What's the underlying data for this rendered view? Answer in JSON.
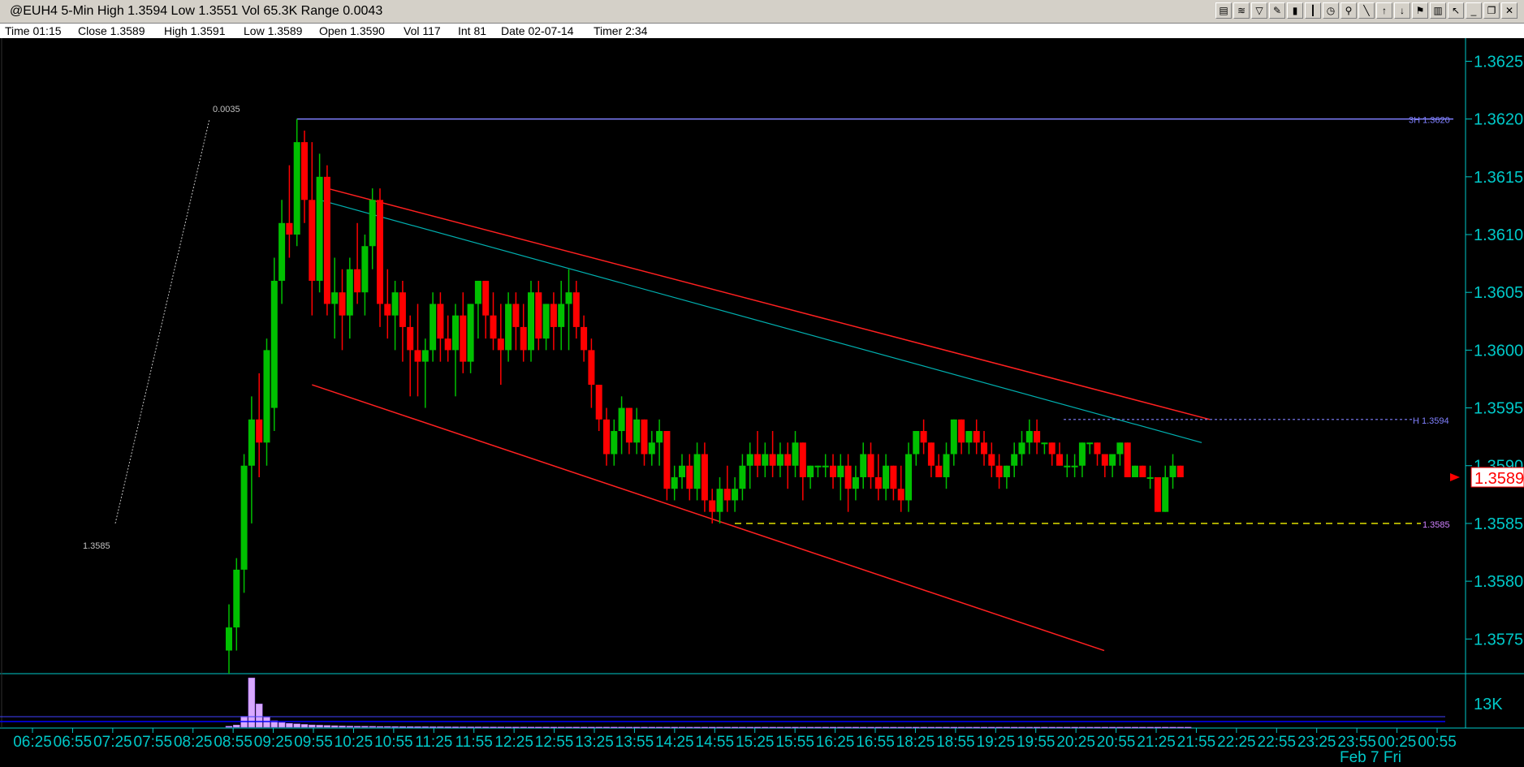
{
  "window": {
    "title": "@EUH4 5-Min High 1.3594 Low 1.3551 Vol 65.3K Range 0.0043",
    "toolbar_icons": [
      "chart-icon",
      "drawing-icon",
      "indicator-icon",
      "pencil-icon",
      "bar-chart-icon",
      "candle-icon",
      "clock-icon",
      "zoom-icon",
      "line-tool-icon",
      "arrow-up-icon",
      "arrow-down-icon",
      "marker-icon",
      "trash-icon",
      "cursor-icon",
      "minimize-icon",
      "restore-icon",
      "close-icon"
    ]
  },
  "infobar": {
    "time": "Time 01:15",
    "close": "Close 1.3589",
    "high": "High 1.3591",
    "low": "Low 1.3589",
    "open": "Open 1.3590",
    "vol": "Vol 117",
    "int": "Int 81",
    "date": "Date 02-07-14",
    "timer": "Timer 2:34"
  },
  "chart_data": {
    "type": "candlestick",
    "symbol": "@EUH4",
    "interval": "5-Min",
    "ylim": [
      1.3572,
      1.3627
    ],
    "y_ticks": [
      "1.3625",
      "1.3620",
      "1.3615",
      "1.3610",
      "1.3605",
      "1.3600",
      "1.3595",
      "1.3590",
      "1.3585",
      "1.3580",
      "1.3575"
    ],
    "last_price": "1.3589",
    "last_price_color": "#ff0000",
    "up_color": "#00c000",
    "down_color": "#ff0000",
    "x_labels": [
      "06:25",
      "06:55",
      "07:25",
      "07:55",
      "08:25",
      "08:55",
      "09:25",
      "09:55",
      "10:25",
      "10:55",
      "11:25",
      "11:55",
      "12:25",
      "12:55",
      "13:25",
      "13:55",
      "14:25",
      "14:55",
      "15:25",
      "15:55",
      "16:25",
      "16:55",
      "18:25",
      "18:55",
      "19:25",
      "19:55",
      "20:25",
      "20:55",
      "21:25",
      "21:55",
      "22:25",
      "22:55",
      "23:25",
      "23:55",
      "00:25",
      "00:55"
    ],
    "date_label": "Feb 7 Fri",
    "annotations": {
      "range_label_top": "0.0035",
      "range_label_bottom": "1.3585",
      "high_line_label": "3H 1.3620",
      "high_line_value": 1.362,
      "h_line_label": "H 1.3594",
      "h_line_value": 1.3594,
      "low_line_label": "1.3585",
      "low_line_value": 1.3585
    },
    "volume_scale_label": "13K",
    "bars": [
      {
        "o": 1.3574,
        "h": 1.3578,
        "l": 1.3572,
        "c": 1.3576
      },
      {
        "o": 1.3576,
        "h": 1.3582,
        "l": 1.3574,
        "c": 1.3581
      },
      {
        "o": 1.3581,
        "h": 1.3591,
        "l": 1.3579,
        "c": 1.359
      },
      {
        "o": 1.359,
        "h": 1.3596,
        "l": 1.3585,
        "c": 1.3594
      },
      {
        "o": 1.3594,
        "h": 1.3598,
        "l": 1.3589,
        "c": 1.3592
      },
      {
        "o": 1.3592,
        "h": 1.3601,
        "l": 1.359,
        "c": 1.36
      },
      {
        "o": 1.3595,
        "h": 1.3608,
        "l": 1.3593,
        "c": 1.3606
      },
      {
        "o": 1.3606,
        "h": 1.3613,
        "l": 1.3604,
        "c": 1.3611
      },
      {
        "o": 1.3611,
        "h": 1.3616,
        "l": 1.3608,
        "c": 1.361
      },
      {
        "o": 1.361,
        "h": 1.362,
        "l": 1.3609,
        "c": 1.3618
      },
      {
        "o": 1.3618,
        "h": 1.3619,
        "l": 1.3611,
        "c": 1.3613
      },
      {
        "o": 1.3613,
        "h": 1.3618,
        "l": 1.3603,
        "c": 1.3606
      },
      {
        "o": 1.3606,
        "h": 1.3617,
        "l": 1.3605,
        "c": 1.3615
      },
      {
        "o": 1.3615,
        "h": 1.3616,
        "l": 1.3603,
        "c": 1.3604
      },
      {
        "o": 1.3604,
        "h": 1.3608,
        "l": 1.3601,
        "c": 1.3605
      },
      {
        "o": 1.3605,
        "h": 1.3607,
        "l": 1.36,
        "c": 1.3603
      },
      {
        "o": 1.3603,
        "h": 1.3608,
        "l": 1.3601,
        "c": 1.3607
      },
      {
        "o": 1.3607,
        "h": 1.3611,
        "l": 1.3604,
        "c": 1.3605
      },
      {
        "o": 1.3605,
        "h": 1.361,
        "l": 1.3603,
        "c": 1.3609
      },
      {
        "o": 1.3609,
        "h": 1.3614,
        "l": 1.3607,
        "c": 1.3613
      },
      {
        "o": 1.3613,
        "h": 1.3614,
        "l": 1.3602,
        "c": 1.3604
      },
      {
        "o": 1.3604,
        "h": 1.3607,
        "l": 1.3601,
        "c": 1.3603
      },
      {
        "o": 1.3603,
        "h": 1.3606,
        "l": 1.36,
        "c": 1.3605
      },
      {
        "o": 1.3605,
        "h": 1.3606,
        "l": 1.3599,
        "c": 1.3602
      },
      {
        "o": 1.3602,
        "h": 1.3603,
        "l": 1.3596,
        "c": 1.36
      },
      {
        "o": 1.36,
        "h": 1.3604,
        "l": 1.3596,
        "c": 1.3599
      },
      {
        "o": 1.3599,
        "h": 1.3601,
        "l": 1.3595,
        "c": 1.36
      },
      {
        "o": 1.36,
        "h": 1.3605,
        "l": 1.3599,
        "c": 1.3604
      },
      {
        "o": 1.3604,
        "h": 1.3605,
        "l": 1.3599,
        "c": 1.3601
      },
      {
        "o": 1.3601,
        "h": 1.3603,
        "l": 1.3599,
        "c": 1.36
      },
      {
        "o": 1.36,
        "h": 1.3604,
        "l": 1.3596,
        "c": 1.3603
      },
      {
        "o": 1.3603,
        "h": 1.3605,
        "l": 1.3598,
        "c": 1.3599
      },
      {
        "o": 1.3599,
        "h": 1.3604,
        "l": 1.3598,
        "c": 1.3604
      },
      {
        "o": 1.3604,
        "h": 1.3606,
        "l": 1.3601,
        "c": 1.3606
      },
      {
        "o": 1.3606,
        "h": 1.3606,
        "l": 1.3601,
        "c": 1.3603
      },
      {
        "o": 1.3603,
        "h": 1.3605,
        "l": 1.36,
        "c": 1.3601
      },
      {
        "o": 1.3601,
        "h": 1.3604,
        "l": 1.3597,
        "c": 1.36
      },
      {
        "o": 1.36,
        "h": 1.3605,
        "l": 1.3599,
        "c": 1.3604
      },
      {
        "o": 1.3604,
        "h": 1.3605,
        "l": 1.36,
        "c": 1.3602
      },
      {
        "o": 1.3602,
        "h": 1.3604,
        "l": 1.3599,
        "c": 1.36
      },
      {
        "o": 1.36,
        "h": 1.3606,
        "l": 1.3599,
        "c": 1.3605
      },
      {
        "o": 1.3605,
        "h": 1.3606,
        "l": 1.36,
        "c": 1.3601
      },
      {
        "o": 1.3601,
        "h": 1.3604,
        "l": 1.36,
        "c": 1.3604
      },
      {
        "o": 1.3604,
        "h": 1.3605,
        "l": 1.36,
        "c": 1.3602
      },
      {
        "o": 1.3602,
        "h": 1.3606,
        "l": 1.36,
        "c": 1.3604
      },
      {
        "o": 1.3604,
        "h": 1.3607,
        "l": 1.36,
        "c": 1.3605
      },
      {
        "o": 1.3605,
        "h": 1.3606,
        "l": 1.3601,
        "c": 1.3602
      },
      {
        "o": 1.3602,
        "h": 1.3603,
        "l": 1.3599,
        "c": 1.36
      },
      {
        "o": 1.36,
        "h": 1.3601,
        "l": 1.3595,
        "c": 1.3597
      },
      {
        "o": 1.3597,
        "h": 1.3597,
        "l": 1.3593,
        "c": 1.3594
      },
      {
        "o": 1.3594,
        "h": 1.3595,
        "l": 1.359,
        "c": 1.3591
      },
      {
        "o": 1.3591,
        "h": 1.3594,
        "l": 1.359,
        "c": 1.3593
      },
      {
        "o": 1.3593,
        "h": 1.3596,
        "l": 1.3591,
        "c": 1.3595
      },
      {
        "o": 1.3595,
        "h": 1.3595,
        "l": 1.3591,
        "c": 1.3592
      },
      {
        "o": 1.3592,
        "h": 1.3595,
        "l": 1.3591,
        "c": 1.3594
      },
      {
        "o": 1.3594,
        "h": 1.3594,
        "l": 1.359,
        "c": 1.3591
      },
      {
        "o": 1.3591,
        "h": 1.3593,
        "l": 1.359,
        "c": 1.3592
      },
      {
        "o": 1.3592,
        "h": 1.3594,
        "l": 1.359,
        "c": 1.3593
      },
      {
        "o": 1.3593,
        "h": 1.3593,
        "l": 1.3587,
        "c": 1.3588
      },
      {
        "o": 1.3588,
        "h": 1.359,
        "l": 1.3587,
        "c": 1.3589
      },
      {
        "o": 1.3589,
        "h": 1.3591,
        "l": 1.3588,
        "c": 1.359
      },
      {
        "o": 1.359,
        "h": 1.3591,
        "l": 1.3587,
        "c": 1.3588
      },
      {
        "o": 1.3588,
        "h": 1.3592,
        "l": 1.3587,
        "c": 1.3591
      },
      {
        "o": 1.3591,
        "h": 1.3592,
        "l": 1.3586,
        "c": 1.3587
      },
      {
        "o": 1.3587,
        "h": 1.3588,
        "l": 1.3585,
        "c": 1.3586
      },
      {
        "o": 1.3586,
        "h": 1.3589,
        "l": 1.3585,
        "c": 1.3588
      },
      {
        "o": 1.3588,
        "h": 1.359,
        "l": 1.3586,
        "c": 1.3587
      },
      {
        "o": 1.3587,
        "h": 1.3589,
        "l": 1.3586,
        "c": 1.3588
      },
      {
        "o": 1.3588,
        "h": 1.3591,
        "l": 1.3587,
        "c": 1.359
      },
      {
        "o": 1.359,
        "h": 1.3592,
        "l": 1.3588,
        "c": 1.3591
      },
      {
        "o": 1.3591,
        "h": 1.3593,
        "l": 1.3589,
        "c": 1.359
      },
      {
        "o": 1.359,
        "h": 1.3592,
        "l": 1.3589,
        "c": 1.3591
      },
      {
        "o": 1.3591,
        "h": 1.3593,
        "l": 1.3589,
        "c": 1.359
      },
      {
        "o": 1.359,
        "h": 1.3592,
        "l": 1.3589,
        "c": 1.3591
      },
      {
        "o": 1.3591,
        "h": 1.3592,
        "l": 1.3588,
        "c": 1.359
      },
      {
        "o": 1.359,
        "h": 1.3593,
        "l": 1.3589,
        "c": 1.3592
      },
      {
        "o": 1.3592,
        "h": 1.3592,
        "l": 1.3587,
        "c": 1.3589
      },
      {
        "o": 1.3589,
        "h": 1.359,
        "l": 1.3588,
        "c": 1.359
      },
      {
        "o": 1.359,
        "h": 1.359,
        "l": 1.3589,
        "c": 1.359
      },
      {
        "o": 1.359,
        "h": 1.3591,
        "l": 1.3589,
        "c": 1.359
      },
      {
        "o": 1.359,
        "h": 1.3591,
        "l": 1.3588,
        "c": 1.3589
      },
      {
        "o": 1.3589,
        "h": 1.3591,
        "l": 1.3587,
        "c": 1.359
      },
      {
        "o": 1.359,
        "h": 1.3591,
        "l": 1.3586,
        "c": 1.3588
      },
      {
        "o": 1.3588,
        "h": 1.359,
        "l": 1.3587,
        "c": 1.3589
      },
      {
        "o": 1.3589,
        "h": 1.3592,
        "l": 1.3588,
        "c": 1.3591
      },
      {
        "o": 1.3591,
        "h": 1.3592,
        "l": 1.3588,
        "c": 1.3589
      },
      {
        "o": 1.3589,
        "h": 1.3591,
        "l": 1.3587,
        "c": 1.3588
      },
      {
        "o": 1.3588,
        "h": 1.3591,
        "l": 1.3587,
        "c": 1.359
      },
      {
        "o": 1.359,
        "h": 1.359,
        "l": 1.3587,
        "c": 1.3588
      },
      {
        "o": 1.3588,
        "h": 1.359,
        "l": 1.3586,
        "c": 1.3587
      },
      {
        "o": 1.3587,
        "h": 1.3592,
        "l": 1.3586,
        "c": 1.3591
      },
      {
        "o": 1.3591,
        "h": 1.3593,
        "l": 1.359,
        "c": 1.3593
      },
      {
        "o": 1.3593,
        "h": 1.3594,
        "l": 1.3591,
        "c": 1.3592
      },
      {
        "o": 1.3592,
        "h": 1.3592,
        "l": 1.3589,
        "c": 1.359
      },
      {
        "o": 1.359,
        "h": 1.3591,
        "l": 1.3589,
        "c": 1.3589
      },
      {
        "o": 1.3589,
        "h": 1.3592,
        "l": 1.3588,
        "c": 1.3591
      },
      {
        "o": 1.3591,
        "h": 1.3594,
        "l": 1.359,
        "c": 1.3594
      },
      {
        "o": 1.3594,
        "h": 1.3594,
        "l": 1.3591,
        "c": 1.3592
      },
      {
        "o": 1.3592,
        "h": 1.3593,
        "l": 1.3591,
        "c": 1.3593
      },
      {
        "o": 1.3593,
        "h": 1.3594,
        "l": 1.3591,
        "c": 1.3592
      },
      {
        "o": 1.3592,
        "h": 1.3593,
        "l": 1.359,
        "c": 1.3591
      },
      {
        "o": 1.3591,
        "h": 1.3592,
        "l": 1.3589,
        "c": 1.359
      },
      {
        "o": 1.359,
        "h": 1.3591,
        "l": 1.3588,
        "c": 1.3589
      },
      {
        "o": 1.3589,
        "h": 1.359,
        "l": 1.3588,
        "c": 1.359
      },
      {
        "o": 1.359,
        "h": 1.3592,
        "l": 1.3589,
        "c": 1.3591
      },
      {
        "o": 1.3591,
        "h": 1.3593,
        "l": 1.359,
        "c": 1.3592
      },
      {
        "o": 1.3592,
        "h": 1.3594,
        "l": 1.3591,
        "c": 1.3593
      },
      {
        "o": 1.3593,
        "h": 1.3594,
        "l": 1.3591,
        "c": 1.3592
      },
      {
        "o": 1.3592,
        "h": 1.3592,
        "l": 1.3591,
        "c": 1.3592
      },
      {
        "o": 1.3592,
        "h": 1.3592,
        "l": 1.359,
        "c": 1.3591
      },
      {
        "o": 1.3591,
        "h": 1.3592,
        "l": 1.359,
        "c": 1.359
      },
      {
        "o": 1.359,
        "h": 1.3591,
        "l": 1.3589,
        "c": 1.359
      },
      {
        "o": 1.359,
        "h": 1.3591,
        "l": 1.3589,
        "c": 1.359
      },
      {
        "o": 1.359,
        "h": 1.3592,
        "l": 1.3589,
        "c": 1.3592
      },
      {
        "o": 1.3592,
        "h": 1.3592,
        "l": 1.3591,
        "c": 1.3592
      },
      {
        "o": 1.3592,
        "h": 1.3592,
        "l": 1.359,
        "c": 1.3591
      },
      {
        "o": 1.3591,
        "h": 1.3591,
        "l": 1.3589,
        "c": 1.359
      },
      {
        "o": 1.359,
        "h": 1.3591,
        "l": 1.3589,
        "c": 1.3591
      },
      {
        "o": 1.3591,
        "h": 1.3592,
        "l": 1.359,
        "c": 1.3592
      },
      {
        "o": 1.3592,
        "h": 1.3592,
        "l": 1.3589,
        "c": 1.3589
      },
      {
        "o": 1.3589,
        "h": 1.359,
        "l": 1.3589,
        "c": 1.359
      },
      {
        "o": 1.359,
        "h": 1.359,
        "l": 1.3589,
        "c": 1.3589
      },
      {
        "o": 1.3589,
        "h": 1.359,
        "l": 1.3588,
        "c": 1.3589
      },
      {
        "o": 1.3589,
        "h": 1.3589,
        "l": 1.3586,
        "c": 1.3586
      },
      {
        "o": 1.3586,
        "h": 1.359,
        "l": 1.3586,
        "c": 1.3589
      },
      {
        "o": 1.3589,
        "h": 1.3591,
        "l": 1.3588,
        "c": 1.359
      },
      {
        "o": 1.359,
        "h": 1.359,
        "l": 1.3589,
        "c": 1.3589
      }
    ],
    "volumes": [
      40,
      85,
      420,
      1900,
      900,
      380,
      250,
      180,
      150,
      130,
      110,
      90,
      80,
      70,
      60,
      50,
      45,
      40,
      40,
      35,
      30,
      30,
      28,
      25,
      22,
      20,
      20,
      18,
      18,
      16,
      15,
      15,
      14,
      14,
      12,
      12,
      12,
      10,
      10,
      10,
      9,
      8,
      8,
      8,
      8,
      7,
      7,
      6,
      6,
      6,
      6,
      6,
      6,
      5,
      5,
      5,
      5,
      5,
      5,
      5,
      5,
      4,
      4,
      4,
      4,
      4,
      4,
      4,
      4,
      4,
      4,
      4,
      4,
      4,
      4,
      4,
      4,
      4,
      4,
      4,
      4,
      4,
      4,
      4,
      3,
      3,
      3,
      3,
      3,
      3,
      3,
      3,
      3,
      3,
      3,
      3,
      3,
      3,
      3,
      3,
      3,
      3,
      3,
      3,
      3,
      3,
      3,
      3,
      3,
      3,
      3,
      3,
      3,
      3,
      3,
      3,
      3,
      3,
      3,
      3,
      3,
      3,
      3,
      3,
      3,
      3,
      3,
      3
    ]
  }
}
